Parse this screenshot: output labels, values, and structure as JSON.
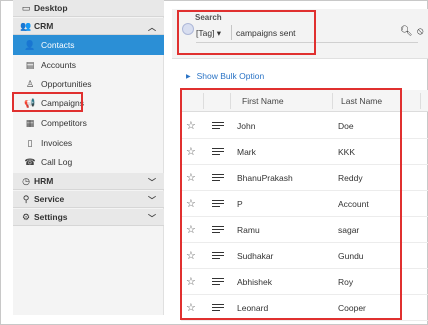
{
  "sidebar": {
    "desktop": "Desktop",
    "crm": "CRM",
    "items": [
      {
        "label": "Contacts",
        "icon": "user-icon"
      },
      {
        "label": "Accounts",
        "icon": "accounts-icon"
      },
      {
        "label": "Opportunities",
        "icon": "trophy-icon"
      },
      {
        "label": "Campaigns",
        "icon": "megaphone-icon"
      },
      {
        "label": "Competitors",
        "icon": "competitors-icon"
      },
      {
        "label": "Invoices",
        "icon": "document-icon"
      },
      {
        "label": "Call Log",
        "icon": "phone-icon"
      }
    ],
    "hrm": "HRM",
    "service": "Service",
    "settings": "Settings"
  },
  "search": {
    "title": "Search",
    "tag": "[Tag] ▾",
    "value": "campaigns sent"
  },
  "bulk_option": "Show Bulk Option",
  "table": {
    "headers": {
      "first_name": "First Name",
      "last_name": "Last Name"
    },
    "rows": [
      {
        "first": "John",
        "last": "Doe"
      },
      {
        "first": "Mark",
        "last": "KKK"
      },
      {
        "first": "BhanuPrakash",
        "last": "Reddy"
      },
      {
        "first": "P",
        "last": "Account"
      },
      {
        "first": "Ramu",
        "last": "sagar"
      },
      {
        "first": "Sudhakar",
        "last": "Gundu"
      },
      {
        "first": "Abhishek",
        "last": "Roy"
      },
      {
        "first": "Leonard",
        "last": "Cooper"
      }
    ]
  },
  "colors": {
    "accent": "#2b8fd6",
    "highlight": "#e0302f",
    "link": "#2a73c5"
  }
}
